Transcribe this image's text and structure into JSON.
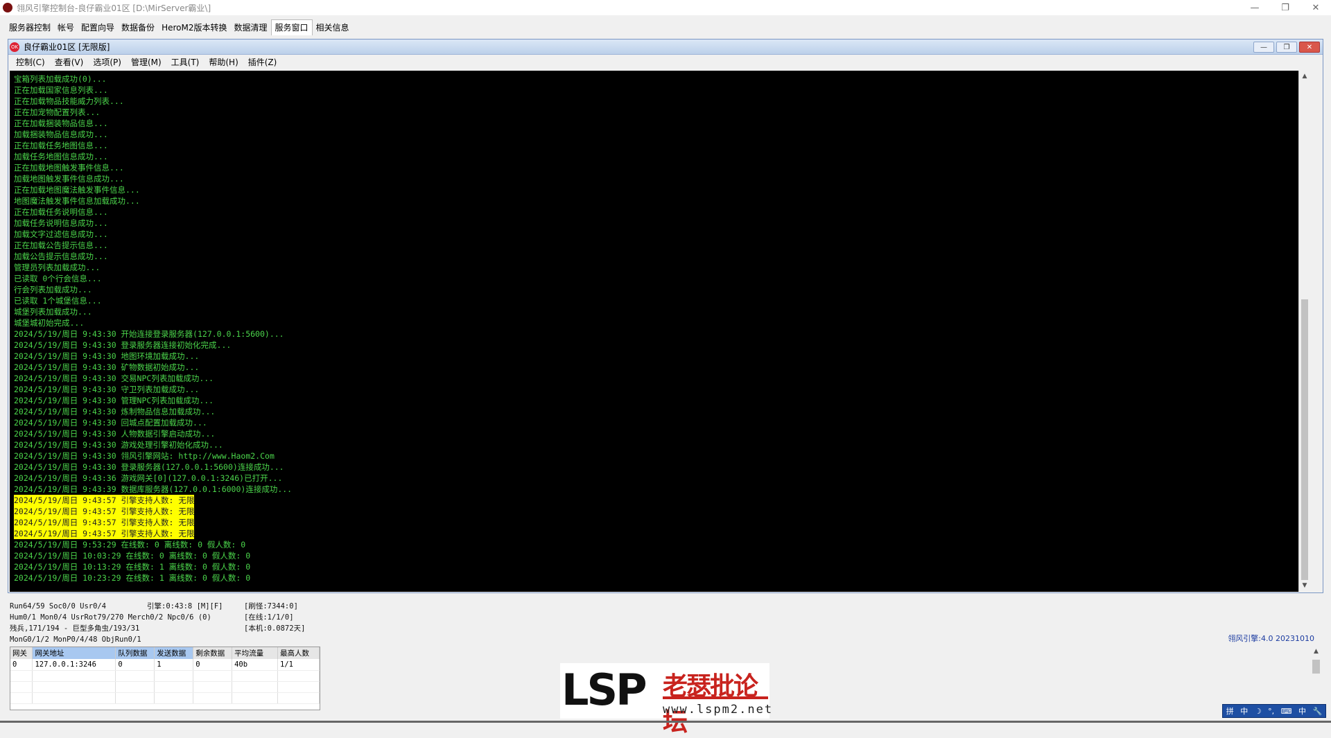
{
  "app": {
    "title": "翎风引擎控制台-良仔霸业01区 [D:\\MirServer霸业\\]",
    "window_controls": [
      "—",
      "❐",
      "✕"
    ]
  },
  "tabs": [
    {
      "label": "服务器控制"
    },
    {
      "label": "帐号"
    },
    {
      "label": "配置向导"
    },
    {
      "label": "数据备份"
    },
    {
      "label": "HeroM2版本转换"
    },
    {
      "label": "数据清理"
    },
    {
      "label": "服务窗口",
      "active": true
    },
    {
      "label": "相关信息"
    }
  ],
  "mdi": {
    "icon_text": "OK",
    "title": "良仔霸业01区 [无限版]",
    "controls": [
      "—",
      "❐",
      "✕"
    ]
  },
  "menu": [
    "控制(C)",
    "查看(V)",
    "选项(P)",
    "管理(M)",
    "工具(T)",
    "帮助(H)",
    "插件(Z)"
  ],
  "console": [
    {
      "t": "宝箱列表加载成功(0)..."
    },
    {
      "t": "正在加载国家信息列表..."
    },
    {
      "t": "正在加载物品技能威力列表..."
    },
    {
      "t": "正在加宠物配置列表..."
    },
    {
      "t": "正在加载捆装物品信息..."
    },
    {
      "t": "加载捆装物品信息成功..."
    },
    {
      "t": "正在加载任务地图信息..."
    },
    {
      "t": "加载任务地图信息成功..."
    },
    {
      "t": "正在加载地图触发事件信息..."
    },
    {
      "t": "加载地图触发事件信息成功..."
    },
    {
      "t": "正在加载地图魔法触发事件信息..."
    },
    {
      "t": "地图魔法触发事件信息加载成功..."
    },
    {
      "t": "正在加载任务说明信息..."
    },
    {
      "t": "加载任务说明信息成功..."
    },
    {
      "t": "加载文字过滤信息成功..."
    },
    {
      "t": "正在加载公告提示信息..."
    },
    {
      "t": "加载公告提示信息成功..."
    },
    {
      "t": "管理员列表加载成功..."
    },
    {
      "t": "已读取 0个行会信息..."
    },
    {
      "t": "行会列表加载成功..."
    },
    {
      "t": "已读取 1个城堡信息..."
    },
    {
      "t": "城堡列表加载成功..."
    },
    {
      "t": "城堡城初始完成..."
    },
    {
      "t": "2024/5/19/周日 9:43:30 开始连接登录服务器(127.0.0.1:5600)..."
    },
    {
      "t": "2024/5/19/周日 9:43:30 登录服务器连接初始化完成..."
    },
    {
      "t": "2024/5/19/周日 9:43:30 地图环境加载成功..."
    },
    {
      "t": "2024/5/19/周日 9:43:30 矿物数据初始成功..."
    },
    {
      "t": "2024/5/19/周日 9:43:30 交易NPC列表加载成功..."
    },
    {
      "t": "2024/5/19/周日 9:43:30 守卫列表加载成功..."
    },
    {
      "t": "2024/5/19/周日 9:43:30 管理NPC列表加载成功..."
    },
    {
      "t": "2024/5/19/周日 9:43:30 炼制物品信息加载成功..."
    },
    {
      "t": "2024/5/19/周日 9:43:30 回城点配置加载成功..."
    },
    {
      "t": "2024/5/19/周日 9:43:30 人物数据引擎启动成功..."
    },
    {
      "t": "2024/5/19/周日 9:43:30 游戏处理引擎初始化成功..."
    },
    {
      "t": "2024/5/19/周日 9:43:30 翎风引擎网站: http://www.Haom2.Com"
    },
    {
      "t": "2024/5/19/周日 9:43:30 登录服务器(127.0.0.1:5600)连接成功..."
    },
    {
      "t": "2024/5/19/周日 9:43:36 游戏网关[0](127.0.0.1:3246)已打开..."
    },
    {
      "t": "2024/5/19/周日 9:43:39 数据库服务器(127.0.0.1:6000)连接成功..."
    },
    {
      "t": "2024/5/19/周日 9:43:57 引擎支持人数: 无限",
      "hl": true
    },
    {
      "t": "2024/5/19/周日 9:43:57 引擎支持人数: 无限",
      "hl": true
    },
    {
      "t": "2024/5/19/周日 9:43:57 引擎支持人数: 无限",
      "hl": true
    },
    {
      "t": "2024/5/19/周日 9:43:57 引擎支持人数: 无限",
      "hl": true
    },
    {
      "t": "2024/5/19/周日 9:53:29 在线数: 0 离线数: 0 假人数: 0"
    },
    {
      "t": "2024/5/19/周日 10:03:29 在线数: 0 离线数: 0 假人数: 0"
    },
    {
      "t": "2024/5/19/周日 10:13:29 在线数: 1 离线数: 0 假人数: 0"
    },
    {
      "t": "2024/5/19/周日 10:23:29 在线数: 1 离线数: 0 假人数: 0"
    }
  ],
  "status": {
    "r1c1": "Run64/59 Soc0/0 Usr0/4",
    "r1c2": "引擎:0:43:8 [M][F]",
    "r1c3": "[刷怪:7344:0]",
    "r2c1": "Hum0/1 Mon0/4 UsrRot79/270 Merch0/2 Npc0/6 (0)",
    "r2c3": "[在线:1/1/0]",
    "r3c1": "残兵,171/194 - 巨型多角虫/193/31",
    "r3c3": "[本机:0.0872天]",
    "r4c1": "MonG0/1/2 MonP0/4/48 ObjRun0/1"
  },
  "version": "翎风引擎:4.0 20231010",
  "gate_table": {
    "headers": [
      "网关",
      "网关地址",
      "队列数据",
      "发送数据",
      "剩余数据",
      "平均流量",
      "最高人数"
    ],
    "rows": [
      [
        "0",
        "127.0.0.1:3246",
        "0",
        "1",
        "0",
        "40b",
        "1/1"
      ]
    ]
  },
  "watermark": {
    "logo_text": "LSP",
    "cn_text": "老瑟批论坛",
    "url": "www.lspm2.net"
  },
  "ime": [
    "拼",
    "中",
    "☽",
    "°,",
    "⌨",
    "中",
    "🔧"
  ]
}
